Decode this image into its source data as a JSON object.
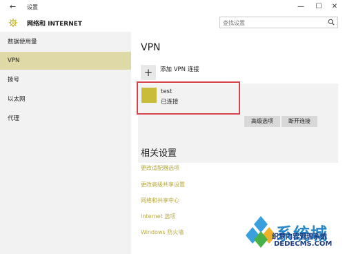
{
  "window": {
    "back_icon": "←",
    "title": "设置",
    "min_icon": "—",
    "max_icon": "☐",
    "close_icon": "✕"
  },
  "header": {
    "section_title": "网络和 INTERNET",
    "search_placeholder": "查找设置"
  },
  "sidebar": {
    "items": [
      {
        "label": "数据使用量"
      },
      {
        "label": "VPN"
      },
      {
        "label": "拨号"
      },
      {
        "label": "以太网"
      },
      {
        "label": "代理"
      }
    ],
    "active_index": 1
  },
  "main": {
    "title": "VPN",
    "add_label": "添加 VPN 连接",
    "plus_icon": "+",
    "connection": {
      "name": "test",
      "status": "已连接"
    },
    "buttons": {
      "advanced": "高级选项",
      "disconnect": "断开连接"
    },
    "related_title": "相关设置",
    "related_links": [
      "更改适配器选项",
      "更改高级共享设置",
      "网络和共享中心",
      "Internet 选项",
      "Windows 防火墙"
    ]
  },
  "watermark": {
    "text": "系统城",
    "sub": "织梦内容管理系统",
    "domain": "DEDECMS.COM"
  },
  "colors": {
    "accent": "#c8bc3a",
    "active_nav": "#ded9a6",
    "link": "#b9a93a",
    "highlight": "#d8434b"
  }
}
